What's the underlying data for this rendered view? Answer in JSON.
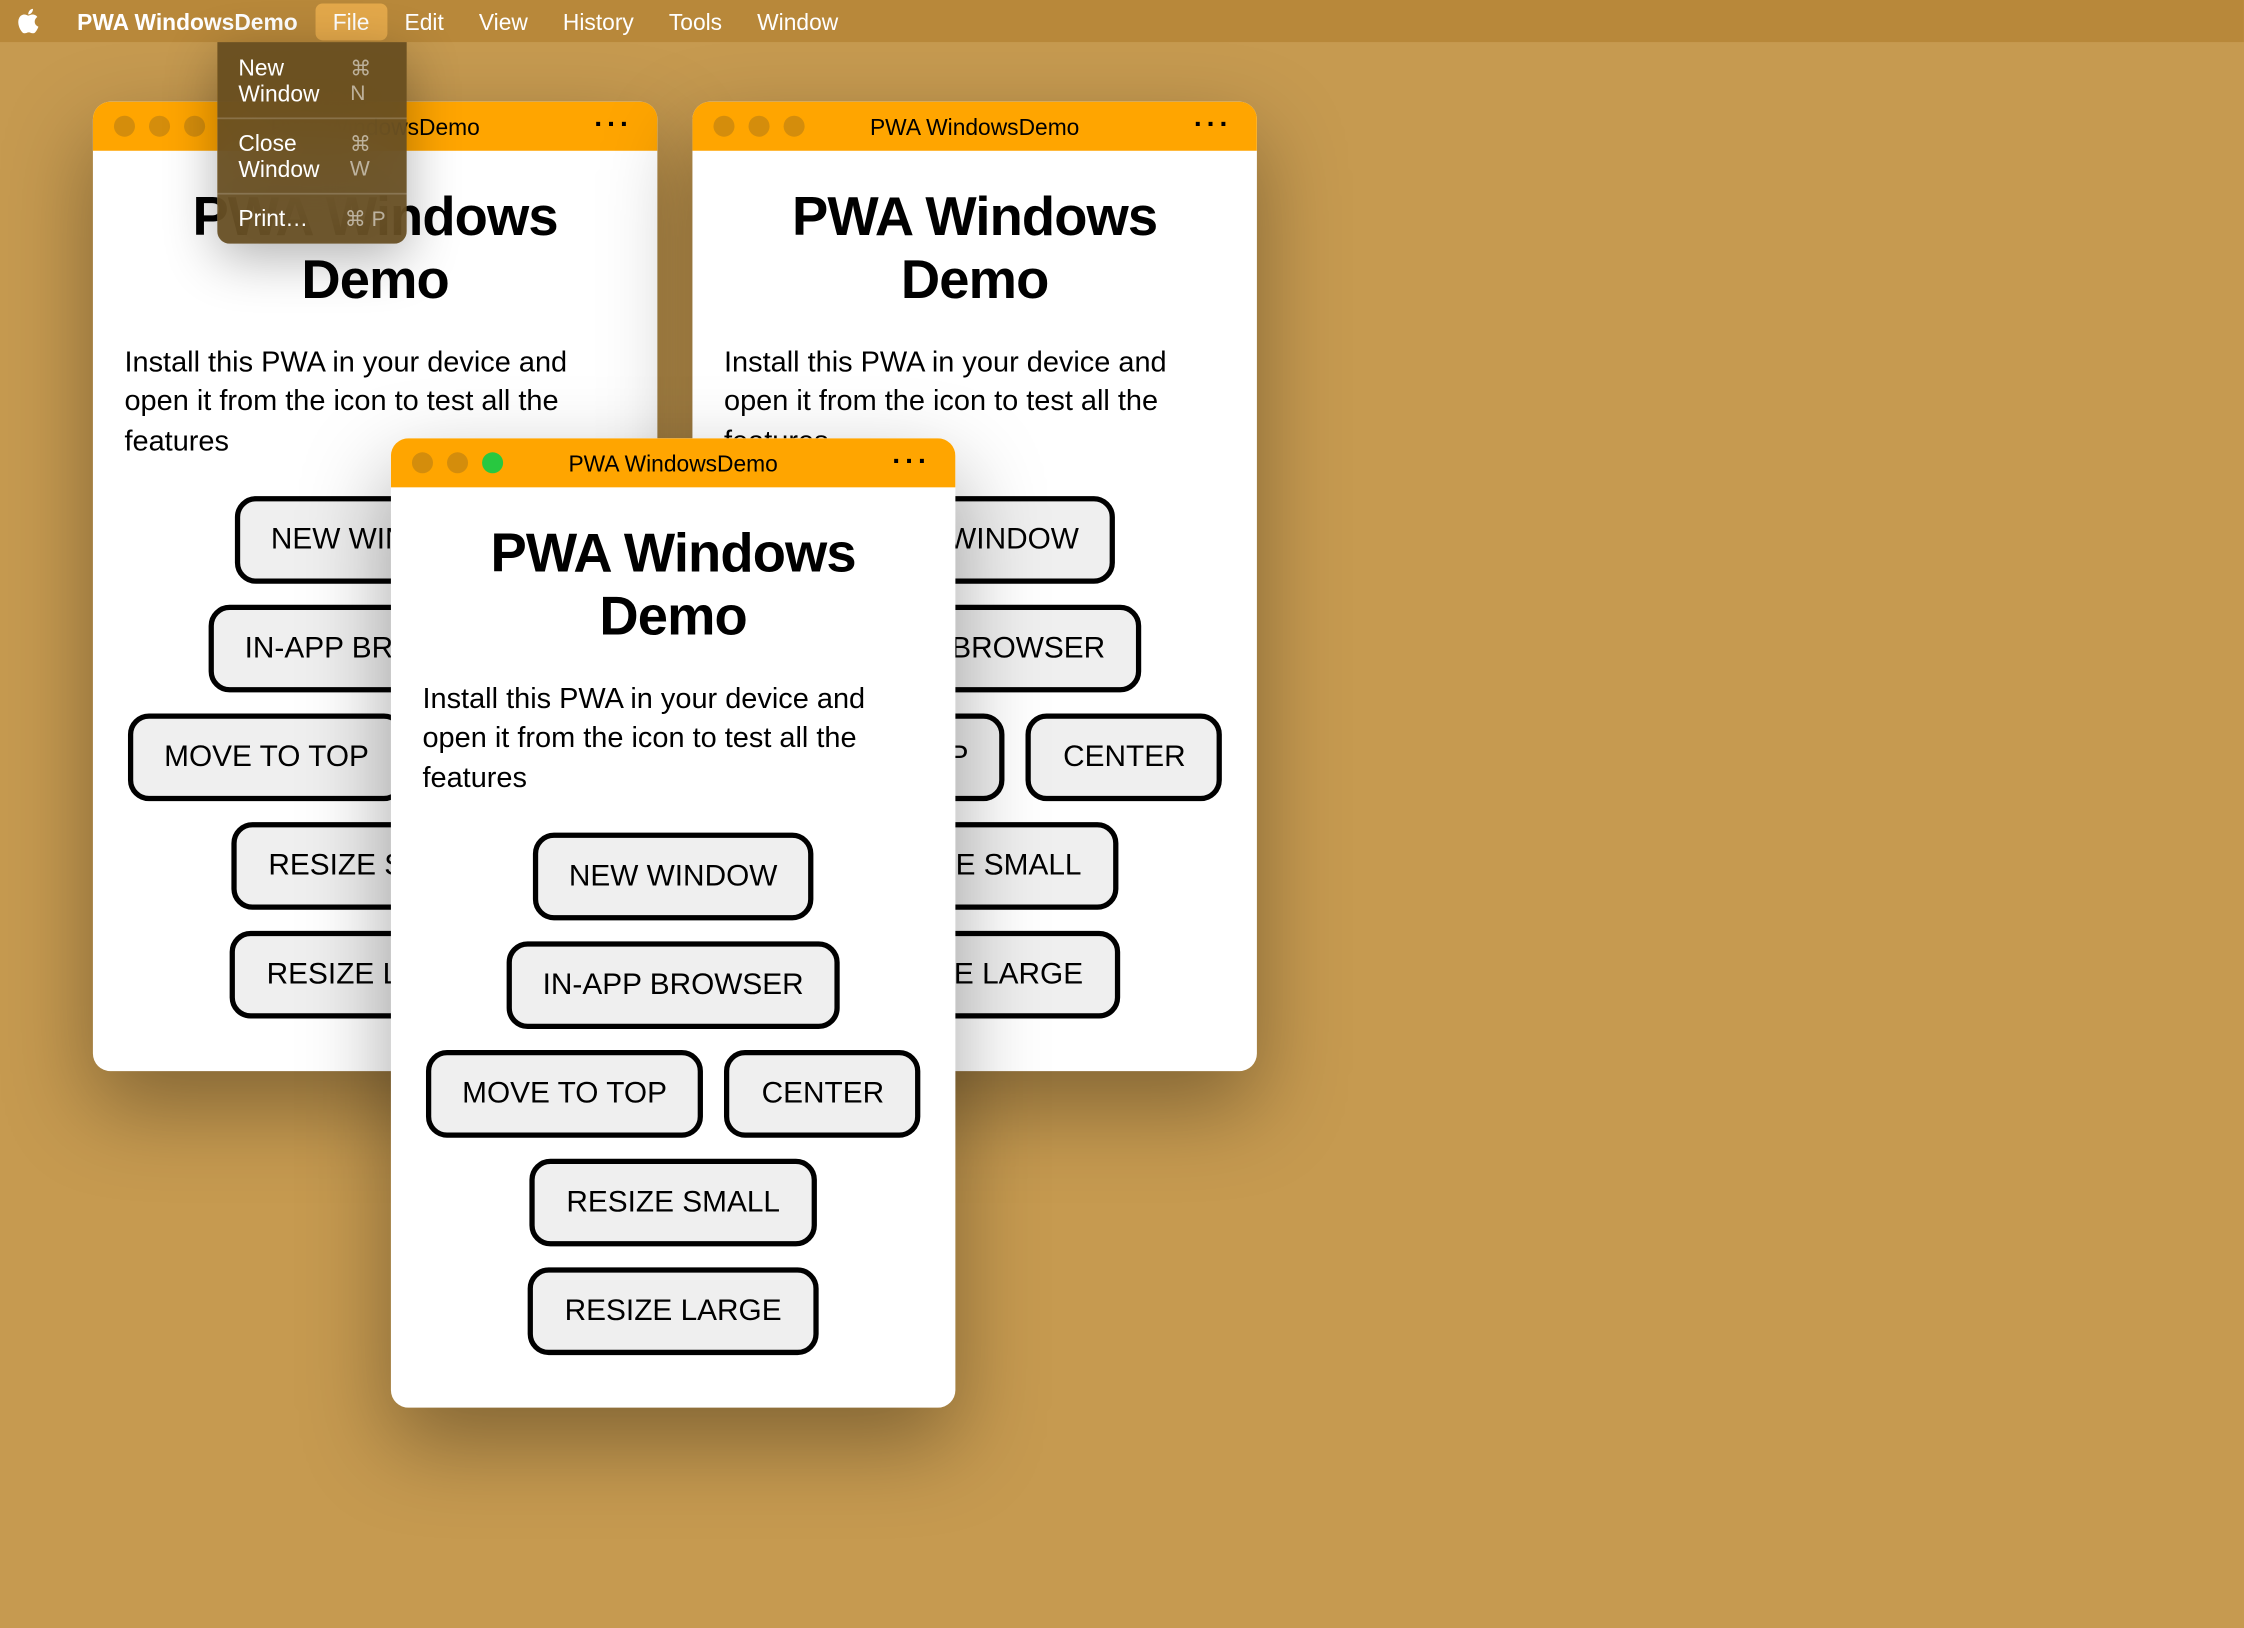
{
  "menubar": {
    "app_name": "PWA WindowsDemo",
    "items": [
      "File",
      "Edit",
      "View",
      "History",
      "Tools",
      "Window"
    ],
    "active_index": 0
  },
  "dropdown": {
    "items": [
      {
        "label": "New Window",
        "shortcut": "⌘ N"
      },
      {
        "label": "Close Window",
        "shortcut": "⌘ W"
      },
      {
        "label": "Print…",
        "shortcut": "⌘ P"
      }
    ]
  },
  "windows": {
    "title": "PWA WindowsDemo",
    "heading": "PWA Windows Demo",
    "description": "Install this PWA in your device and open it from the icon to test all the features",
    "buttons": [
      "NEW WINDOW",
      "IN-APP BROWSER",
      "MOVE TO TOP",
      "CENTER",
      "RESIZE SMALL",
      "RESIZE LARGE"
    ],
    "menu_dots": "···"
  },
  "window_states": [
    {
      "active": false
    },
    {
      "active": false
    },
    {
      "active": true
    }
  ]
}
